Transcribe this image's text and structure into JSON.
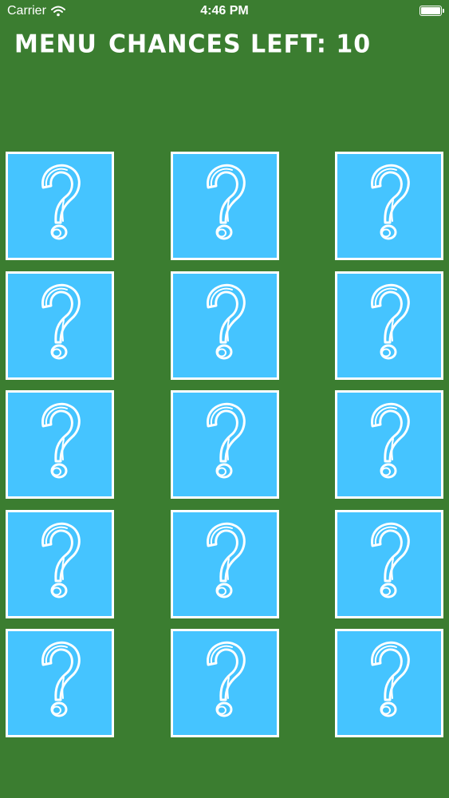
{
  "status_bar": {
    "carrier": "Carrier",
    "time": "4:46 PM",
    "wifi_icon": "wifi-icon",
    "battery_icon": "battery-icon"
  },
  "header": {
    "menu_label": "MENU",
    "chances_label": "CHANCES LEFT: 10"
  },
  "board": {
    "rows": 5,
    "columns": 3,
    "card_icon": "question-mark-icon",
    "cards": [
      {
        "state": "hidden"
      },
      {
        "state": "hidden"
      },
      {
        "state": "hidden"
      },
      {
        "state": "hidden"
      },
      {
        "state": "hidden"
      },
      {
        "state": "hidden"
      },
      {
        "state": "hidden"
      },
      {
        "state": "hidden"
      },
      {
        "state": "hidden"
      },
      {
        "state": "hidden"
      },
      {
        "state": "hidden"
      },
      {
        "state": "hidden"
      },
      {
        "state": "hidden"
      },
      {
        "state": "hidden"
      },
      {
        "state": "hidden"
      }
    ]
  },
  "colors": {
    "background": "#3b7d30",
    "card_face": "#45c4ff",
    "card_border": "#ffffff",
    "text": "#ffffff"
  }
}
